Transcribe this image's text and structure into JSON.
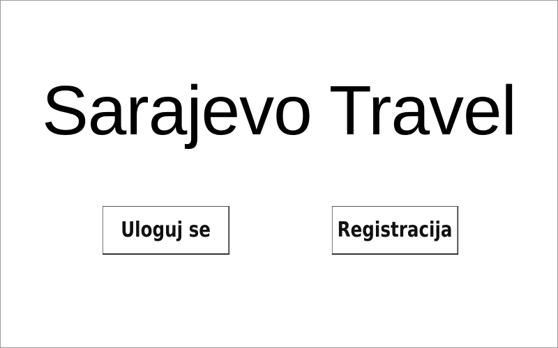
{
  "app": {
    "title": "Sarajevo Travel"
  },
  "actions": {
    "login_label": "Uloguj se",
    "register_label": "Registracija"
  }
}
